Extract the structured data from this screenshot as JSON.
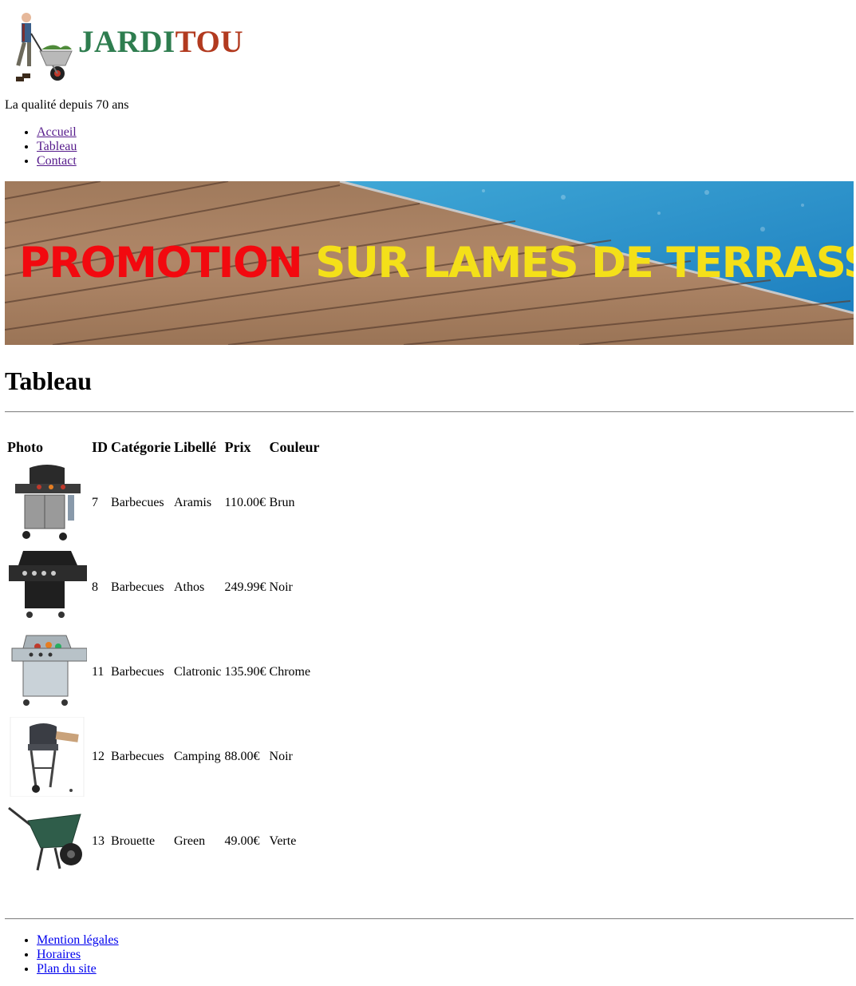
{
  "header": {
    "brand_part1": "JARDI",
    "brand_part2": "TOU",
    "brand_color1": "#2e7d4f",
    "brand_color2": "#b23a1f",
    "tagline": "La qualité depuis 70 ans"
  },
  "nav": {
    "items": [
      {
        "label": "Accueil"
      },
      {
        "label": "Tableau"
      },
      {
        "label": "Contact"
      }
    ]
  },
  "banner": {
    "part1": "PROMOTION",
    "part2": " SUR LAMES DE TERRASSE",
    "color1": "#f2090f",
    "color2": "#f4e019"
  },
  "page": {
    "title": "Tableau"
  },
  "table": {
    "headers": [
      "Photo",
      "ID",
      "Catégorie",
      "Libellé",
      "Prix",
      "Couleur"
    ],
    "rows": [
      {
        "image": "barbecue-grill-icon",
        "id": "7",
        "category": "Barbecues",
        "label": "Aramis",
        "price": "110.00€",
        "color": "Brun"
      },
      {
        "image": "barbecue-grill-icon",
        "id": "8",
        "category": "Barbecues",
        "label": "Athos",
        "price": "249.99€",
        "color": "Noir"
      },
      {
        "image": "barbecue-grill-icon",
        "id": "11",
        "category": "Barbecues",
        "label": "Clatronic",
        "price": "135.90€",
        "color": "Chrome"
      },
      {
        "image": "barbecue-grill-icon",
        "id": "12",
        "category": "Barbecues",
        "label": "Camping",
        "price": "88.00€",
        "color": "Noir"
      },
      {
        "image": "wheelbarrow-icon",
        "id": "13",
        "category": "Brouette",
        "label": "Green",
        "price": "49.00€",
        "color": "Verte"
      }
    ]
  },
  "footer": {
    "links": [
      {
        "label": "Mention légales"
      },
      {
        "label": "Horaires"
      },
      {
        "label": "Plan du site"
      }
    ]
  }
}
